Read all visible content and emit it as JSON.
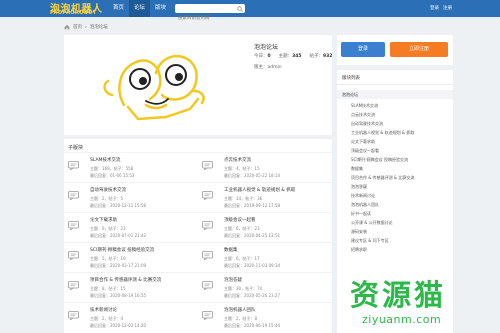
{
  "logo": {
    "cn": "泡泡机器人",
    "en": "PAOPAOROBOT"
  },
  "nav": {
    "items": [
      "首页",
      "论坛",
      "版块"
    ],
    "active_index": 1
  },
  "search": {
    "placeholder": "搜索目前暂用网"
  },
  "auth": {
    "login": "登录",
    "register": "注册"
  },
  "breadcrumb": {
    "home": "首页",
    "separator": "›",
    "current": "泡泡论坛"
  },
  "forum": {
    "title": "泡泡论坛",
    "stats": [
      {
        "label": "今日：",
        "value": "0"
      },
      {
        "label": "主题：",
        "value": "345"
      },
      {
        "label": "帖子：",
        "value": "932"
      }
    ],
    "moderator": "版主：admin"
  },
  "subforums": {
    "title": "子版块",
    "items": [
      {
        "name": "SLAM技术交流",
        "count": "主题：169，帖子：556",
        "last": "最后回复：01-06 15:53"
      },
      {
        "name": "点云技术交流",
        "count": "主题：4，帖子：15",
        "last": "最后回复：2020-05-22 18:14"
      },
      {
        "name": "自动驾驶技术交流",
        "count": "主题：2，帖子：5",
        "last": "最后回复：2020-12-11 15:58"
      },
      {
        "name": "工业机器人视觉 & 轨迹规划 & 抓取",
        "count": "主题：14，帖子：36",
        "last": "最后回复：2019-09-12 17:58"
      },
      {
        "name": "论文下载求助",
        "count": "主题：9，帖子：23",
        "last": "最后回复：2020-07-01 21:42"
      },
      {
        "name": "顶级会议一起看",
        "count": "主题：6，帖子：23",
        "last": "最后回复：2020-04-25 13:51"
      },
      {
        "name": "SCI期刊·顾稿会议 投稿经验交流",
        "count": "主题：5，帖子：19",
        "last": "最后回复：2020-03-17 21:09"
      },
      {
        "name": "数据集",
        "count": "主题：6，帖子：17",
        "last": "最后回复：2020-11-03 09:34"
      },
      {
        "name": "项目合作 & 传感器评测 & 比赛交流",
        "count": "主题：8，帖子：15",
        "last": "最后回复：2020-08-19 16:55"
      },
      {
        "name": "泡泡答疑",
        "count": "主题：30，帖子：74",
        "last": "最后回复：2020-05-26 23:27"
      },
      {
        "name": "技术新闻讨论",
        "count": "主题：2，帖子：4",
        "last": "最后回复：2020-12-03 14:20"
      },
      {
        "name": "泡泡机器人团队",
        "count": "主题：2，帖子：8",
        "last": "最后回复：2020-06-19 15:44"
      }
    ]
  },
  "buttons": {
    "login": "登录",
    "register": "立即注册"
  },
  "sidebar": {
    "title": "版块列表",
    "items": [
      {
        "label": "泡泡论坛",
        "kind": "head"
      },
      {
        "label": "SLAM技术交流",
        "kind": "child"
      },
      {
        "label": "点云技术交流",
        "kind": "child"
      },
      {
        "label": "自动驾驶技术交流",
        "kind": "child"
      },
      {
        "label": "工业机器人视觉 & 轨迹规划 & 抓取",
        "kind": "child"
      },
      {
        "label": "论文下载求助",
        "kind": "child"
      },
      {
        "label": "顶级会议一起看",
        "kind": "child"
      },
      {
        "label": "SCI期刊·顾稿会议 投稿经验交流",
        "kind": "child"
      },
      {
        "label": "数据集",
        "kind": "child"
      },
      {
        "label": "项目合作 & 传感器评测 & 比赛交流",
        "kind": "child"
      },
      {
        "label": "泡泡答疑",
        "kind": "child"
      },
      {
        "label": "技术新闻讨论",
        "kind": "child"
      },
      {
        "label": "泡泡机器人团队",
        "kind": "child"
      },
      {
        "label": "好书一起读",
        "kind": "child"
      },
      {
        "label": "公开课 & 公开数据讨论",
        "kind": "child"
      },
      {
        "label": "源码安装",
        "kind": "child"
      },
      {
        "label": "建议专区 & 问下专区",
        "kind": "child"
      },
      {
        "label": "招聘求职",
        "kind": "child"
      }
    ]
  },
  "watermark": {
    "cn": "资源猫",
    "en": "ziyuanm.com"
  },
  "colors": {
    "brand": "#2b70b6",
    "logo": "#ffd23a",
    "login": "#3a7fd0",
    "register": "#f57c22",
    "watermark": "#2db84a"
  }
}
